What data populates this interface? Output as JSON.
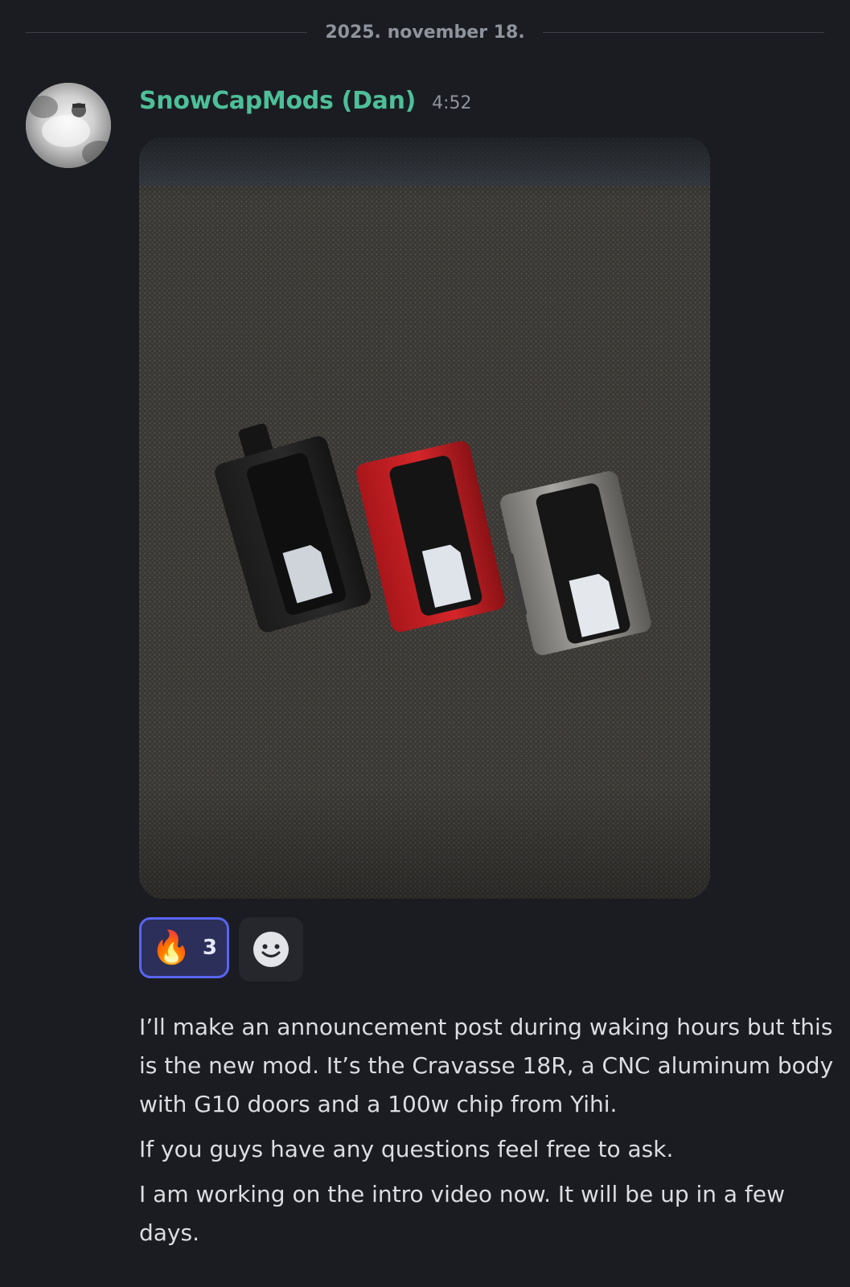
{
  "divider": {
    "date": "2025. november 18."
  },
  "message": {
    "author": "SnowCapMods (Dan)",
    "time": "4:52",
    "avatar_icon": "user-avatar",
    "image_icon": "attachment-photo",
    "reactions": [
      {
        "emoji": "🔥",
        "icon": "fire-emoji",
        "count": "3",
        "active": true
      }
    ],
    "add_reaction_icon": "add-reaction-smiley-icon",
    "paragraphs": [
      "I’ll make an announcement post during waking hours but this is the new mod. It’s the Cravasse 18R, a CNC aluminum body with G10 doors and a 100w chip from Yihi.",
      "If you guys have any questions feel free to ask.",
      "I am working on the intro video now. It will be up in a few days."
    ]
  },
  "colors": {
    "background": "#1b1c21",
    "username": "#4dbf99",
    "muted": "#8f939c",
    "reaction_active_border": "#5865f2",
    "reaction_active_bg": "#2c2f5a"
  }
}
